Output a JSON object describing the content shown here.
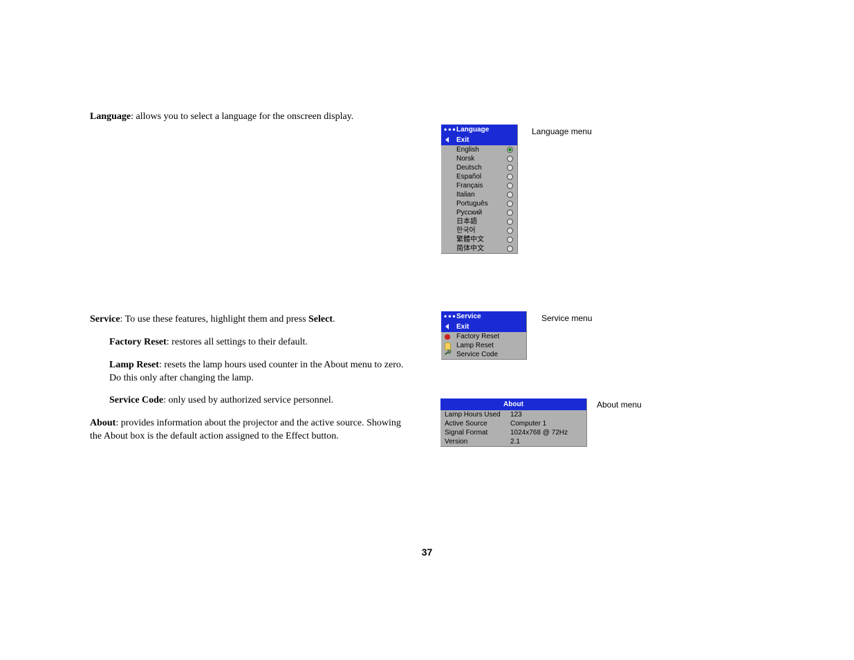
{
  "text": {
    "language_label": "Language",
    "language_desc": ": allows you to select a language for the onscreen display.",
    "service_label": "Service",
    "service_desc_a": ": To use these features, highlight them and press ",
    "service_desc_b": "Select",
    "service_desc_c": ".",
    "factory_reset_label": "Factory Reset",
    "factory_reset_desc": ": restores all settings to their default.",
    "lamp_reset_label": "Lamp Reset",
    "lamp_reset_desc": ": resets the lamp hours used counter in the About menu to zero. Do this only after changing the lamp.",
    "service_code_label": "Service Code",
    "service_code_desc": ": only used by authorized service personnel.",
    "about_label": "About",
    "about_desc": ": provides information about the projector and the active source. Showing the About box is the default action assigned to the Effect button."
  },
  "captions": {
    "language": "Language menu",
    "service": "Service menu",
    "about": "About menu"
  },
  "language_menu": {
    "title": "Language",
    "exit": "Exit",
    "items": [
      {
        "label": "English",
        "selected": true
      },
      {
        "label": "Norsk",
        "selected": false
      },
      {
        "label": "Deutsch",
        "selected": false
      },
      {
        "label": "Español",
        "selected": false
      },
      {
        "label": "Français",
        "selected": false
      },
      {
        "label": "Italian",
        "selected": false
      },
      {
        "label": "Português",
        "selected": false
      },
      {
        "label": "Русский",
        "selected": false
      },
      {
        "label": "日本語",
        "selected": false
      },
      {
        "label": "한국어",
        "selected": false
      },
      {
        "label": "繁體中文",
        "selected": false
      },
      {
        "label": "简体中文",
        "selected": false
      }
    ]
  },
  "service_menu": {
    "title": "Service",
    "exit": "Exit",
    "items": [
      {
        "label": "Factory Reset",
        "icon": "dot-red"
      },
      {
        "label": "Lamp Reset",
        "icon": "bulb"
      },
      {
        "label": "Service Code",
        "icon": "wrench"
      }
    ]
  },
  "about_box": {
    "title": "About",
    "rows": [
      {
        "k": "Lamp Hours Used",
        "v": "123"
      },
      {
        "k": "Active Source",
        "v": "Computer 1"
      },
      {
        "k": "Signal Format",
        "v": "1024x768 @ 72Hz"
      },
      {
        "k": "Version",
        "v": "2.1"
      }
    ]
  },
  "page_number": "37"
}
